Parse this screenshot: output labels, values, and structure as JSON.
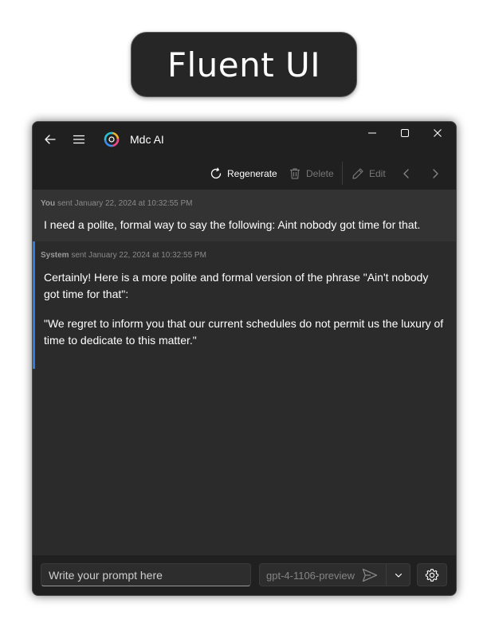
{
  "banner": {
    "text": "Fluent UI"
  },
  "window": {
    "title": "Mdc AI",
    "icons": {
      "back": "back-arrow-icon",
      "menu": "hamburger-menu-icon",
      "logo": "app-logo-icon",
      "minimize": "minimize-icon",
      "maximize": "maximize-icon",
      "close": "close-icon"
    }
  },
  "toolbar": {
    "regenerate_label": "Regenerate",
    "delete_label": "Delete",
    "edit_label": "Edit",
    "icons": {
      "regenerate": "refresh-icon",
      "delete": "trash-icon",
      "edit": "pencil-icon",
      "previous": "chevron-left-icon",
      "next": "chevron-right-icon"
    }
  },
  "messages": [
    {
      "role": "You",
      "sent_text": "sent January 22, 2024 at 10:32:55 PM",
      "paragraphs": [
        "I need a polite, formal way to say the following: Aint nobody got time for that."
      ]
    },
    {
      "role": "System",
      "sent_text": "sent January 22, 2024 at 10:32:55 PM",
      "paragraphs": [
        "Certainly! Here is a more polite and formal version of the phrase \"Ain't nobody got time for that\":",
        "\"We regret to inform you that our current schedules do not permit us the luxury of time to dedicate to this matter.\""
      ]
    }
  ],
  "input": {
    "placeholder": "Write your prompt here",
    "value": ""
  },
  "model": {
    "selected": "gpt-4-1106-preview",
    "icons": {
      "send": "send-icon",
      "dropdown": "chevron-down-icon",
      "settings": "gear-icon"
    }
  },
  "colors": {
    "accent": "#2f7fe0",
    "background": "#2b2b2b",
    "titlebar": "#202020"
  }
}
